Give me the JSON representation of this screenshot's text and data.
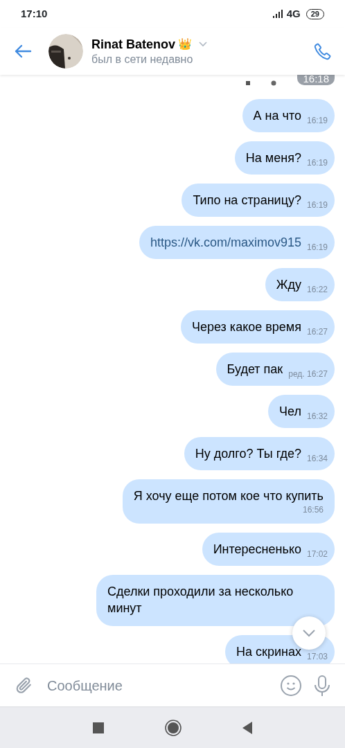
{
  "status_bar": {
    "time": "17:10",
    "network": "4G",
    "battery": "29"
  },
  "header": {
    "name": "Rinat Batenov",
    "badge": "👑",
    "status": "был в сети недавно"
  },
  "top_time": "16:18",
  "messages": [
    {
      "kind": "text",
      "text": "А на что",
      "time": "16:19"
    },
    {
      "kind": "text",
      "text": "На меня?",
      "time": "16:19"
    },
    {
      "kind": "text",
      "text": "Типо на страницу?",
      "time": "16:19"
    },
    {
      "kind": "link",
      "text": "https://vk.com/maximov915",
      "time": "16:19"
    },
    {
      "kind": "text",
      "text": "Жду",
      "time": "16:22"
    },
    {
      "kind": "text",
      "text": "Через какое время",
      "time": "16:27"
    },
    {
      "kind": "text",
      "text": "Будет пак",
      "edited": "ред.",
      "time": "16:27"
    },
    {
      "kind": "text",
      "text": "Чел",
      "time": "16:32"
    },
    {
      "kind": "text",
      "text": "Ну долго? Ты где?",
      "time": "16:34"
    },
    {
      "kind": "text",
      "text": "Я хочу еще потом кое что купить",
      "time": "16:56",
      "wrap": true
    },
    {
      "kind": "text",
      "text": "Интересненько",
      "time": "17:02"
    },
    {
      "kind": "text",
      "text": "Сделки проходили за несколько минут",
      "wrap": true
    },
    {
      "kind": "text",
      "text": "На скринах",
      "time": "17:03"
    }
  ],
  "composer": {
    "placeholder": "Сообщение"
  }
}
